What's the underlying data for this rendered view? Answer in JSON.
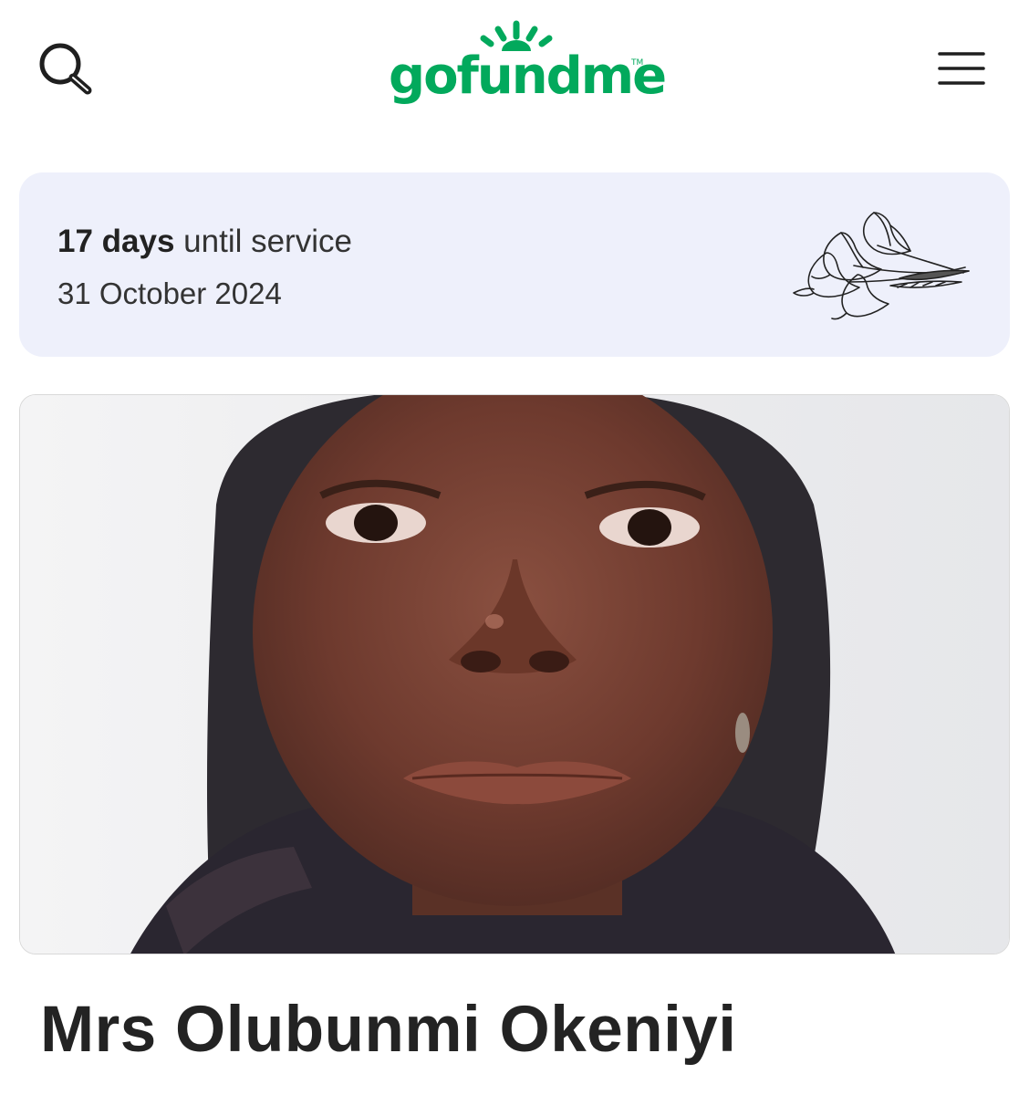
{
  "header": {
    "logo_text": "gofundme",
    "logo_tm": "TM",
    "brand_color": "#02a95c",
    "search_icon": "search-icon",
    "menu_icon": "hamburger-menu-icon"
  },
  "service": {
    "days_count": "17 days",
    "days_suffix": " until service",
    "date": "31 October 2024",
    "icon": "lily-flowers-icon",
    "background_color": "#eef0fb"
  },
  "campaign": {
    "title": "Mrs Olubunmi Okeniyi"
  }
}
